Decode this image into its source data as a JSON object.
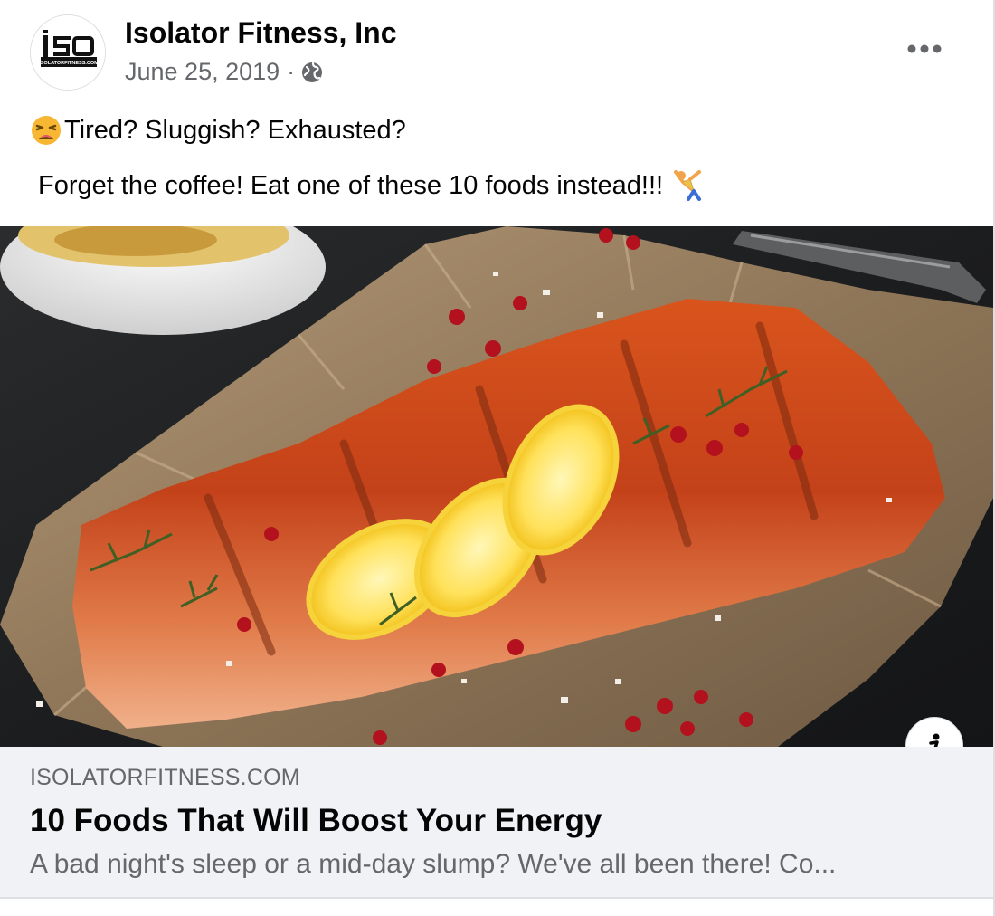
{
  "post": {
    "page_name": "Isolator Fitness, Inc",
    "date": "June 25, 2019",
    "separator": "·",
    "privacy_icon": "globe-icon",
    "more_icon": "more-options-icon",
    "avatar": {
      "logo_text": "iSO",
      "logo_subtext": "ISOLATORFITNESS.COM"
    },
    "message_line1": "Tired? Sluggish?  Exhausted?",
    "message_line1_emoji": "tired-face-emoji",
    "message_line2": "Forget the coffee! Eat one of these 10 foods instead!!!",
    "message_line2_emoji": "person-cartwheeling-emoji"
  },
  "image": {
    "subject": "grilled-salmon-photo",
    "info_icon": "info-icon"
  },
  "link_preview": {
    "domain": "ISOLATORFITNESS.COM",
    "title": "10 Foods That Will Boost Your Energy",
    "description": "A bad night's sleep or a mid-day slump? We've all been there! Co..."
  },
  "colors": {
    "primary_text": "#050505",
    "secondary_text": "#65676b",
    "link_box_bg": "#f0f2f5",
    "divider": "#dddfe2"
  }
}
